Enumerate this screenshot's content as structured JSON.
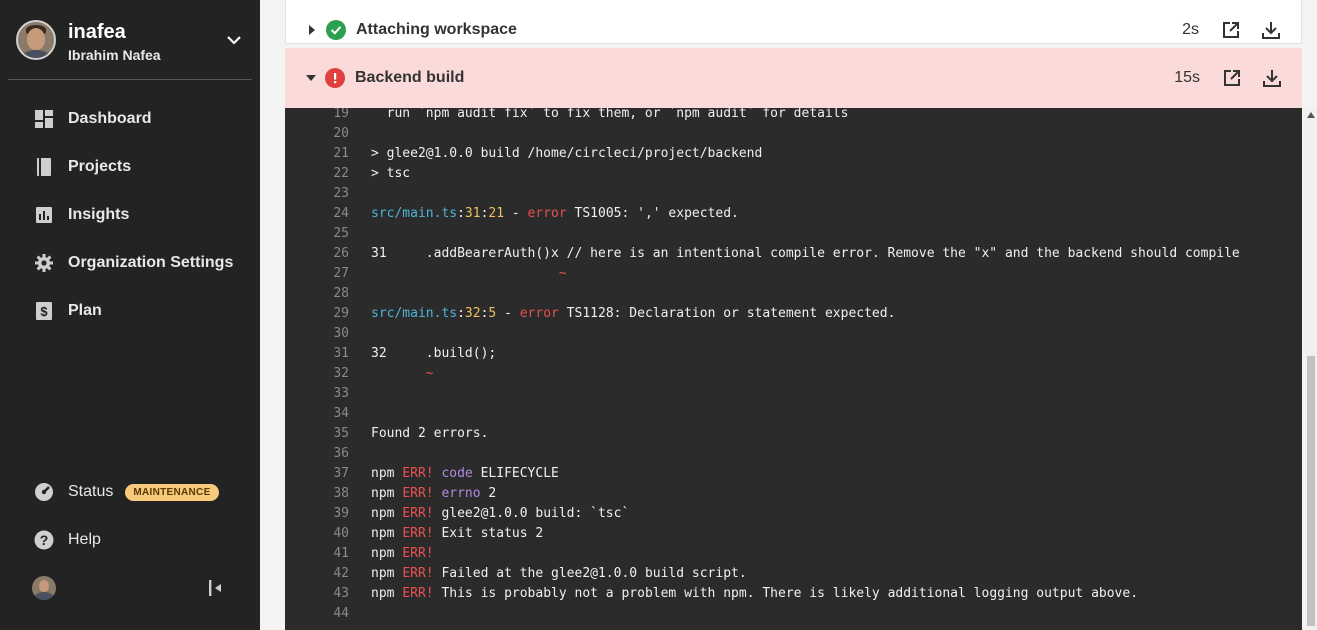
{
  "user": {
    "org": "inafea",
    "name": "Ibrahim Nafea"
  },
  "nav": {
    "items": [
      {
        "label": "Dashboard",
        "icon": "dashboard-icon"
      },
      {
        "label": "Projects",
        "icon": "projects-icon"
      },
      {
        "label": "Insights",
        "icon": "insights-icon"
      },
      {
        "label": "Organization Settings",
        "icon": "gear-icon"
      },
      {
        "label": "Plan",
        "icon": "dollar-icon"
      }
    ],
    "status_label": "Status",
    "status_badge": "MAINTENANCE",
    "help_label": "Help"
  },
  "steps": [
    {
      "title": "Attaching workspace",
      "duration": "2s",
      "state": "success"
    },
    {
      "title": "Backend build",
      "duration": "15s",
      "state": "failed"
    }
  ],
  "colors": {
    "sidebar_bg": "#232323",
    "success": "#2e9e4f",
    "error": "#e04040",
    "failed_bg": "#fbdada",
    "log_bg": "#2b2b2b"
  },
  "log_lines": [
    {
      "n": "19",
      "segs": [
        {
          "t": "  run `npm audit fix` to fix them, or `npm audit` for details",
          "c": ""
        }
      ]
    },
    {
      "n": "20",
      "segs": []
    },
    {
      "n": "21",
      "segs": [
        {
          "t": "> glee2@1.0.0 build /home/circleci/project/backend",
          "c": ""
        }
      ]
    },
    {
      "n": "22",
      "segs": [
        {
          "t": "> tsc",
          "c": ""
        }
      ]
    },
    {
      "n": "23",
      "segs": []
    },
    {
      "n": "24",
      "segs": [
        {
          "t": "src/main.ts",
          "c": "c-blue"
        },
        {
          "t": ":",
          "c": ""
        },
        {
          "t": "31",
          "c": "c-yellow"
        },
        {
          "t": ":",
          "c": ""
        },
        {
          "t": "21",
          "c": "c-yellow"
        },
        {
          "t": " - ",
          "c": ""
        },
        {
          "t": "error",
          "c": "c-red"
        },
        {
          "t": " TS1005: ',' expected.",
          "c": ""
        }
      ]
    },
    {
      "n": "25",
      "segs": []
    },
    {
      "n": "26",
      "segs": [
        {
          "t": "31     .addBearerAuth()x // here is an intentional compile error. Remove the \"x\" and the backend should compile",
          "c": ""
        }
      ]
    },
    {
      "n": "27",
      "segs": [
        {
          "t": "                        ~",
          "c": "c-red"
        }
      ]
    },
    {
      "n": "28",
      "segs": []
    },
    {
      "n": "29",
      "segs": [
        {
          "t": "src/main.ts",
          "c": "c-blue"
        },
        {
          "t": ":",
          "c": ""
        },
        {
          "t": "32",
          "c": "c-yellow"
        },
        {
          "t": ":",
          "c": ""
        },
        {
          "t": "5",
          "c": "c-yellow"
        },
        {
          "t": " - ",
          "c": ""
        },
        {
          "t": "error",
          "c": "c-red"
        },
        {
          "t": " TS1128: Declaration or statement expected.",
          "c": ""
        }
      ]
    },
    {
      "n": "30",
      "segs": []
    },
    {
      "n": "31",
      "segs": [
        {
          "t": "32     .build();",
          "c": ""
        }
      ]
    },
    {
      "n": "32",
      "segs": [
        {
          "t": "       ~",
          "c": "c-red"
        }
      ]
    },
    {
      "n": "33",
      "segs": []
    },
    {
      "n": "34",
      "segs": []
    },
    {
      "n": "35",
      "segs": [
        {
          "t": "Found 2 errors.",
          "c": ""
        }
      ]
    },
    {
      "n": "36",
      "segs": []
    },
    {
      "n": "37",
      "segs": [
        {
          "t": "npm ",
          "c": ""
        },
        {
          "t": "ERR!",
          "c": "c-red"
        },
        {
          "t": " ",
          "c": ""
        },
        {
          "t": "code",
          "c": "c-purple"
        },
        {
          "t": " ELIFECYCLE",
          "c": ""
        }
      ]
    },
    {
      "n": "38",
      "segs": [
        {
          "t": "npm ",
          "c": ""
        },
        {
          "t": "ERR!",
          "c": "c-red"
        },
        {
          "t": " ",
          "c": ""
        },
        {
          "t": "errno",
          "c": "c-purple"
        },
        {
          "t": " 2",
          "c": ""
        }
      ]
    },
    {
      "n": "39",
      "segs": [
        {
          "t": "npm ",
          "c": ""
        },
        {
          "t": "ERR!",
          "c": "c-red"
        },
        {
          "t": " glee2@1.0.0 build: `tsc`",
          "c": ""
        }
      ]
    },
    {
      "n": "40",
      "segs": [
        {
          "t": "npm ",
          "c": ""
        },
        {
          "t": "ERR!",
          "c": "c-red"
        },
        {
          "t": " Exit status 2",
          "c": ""
        }
      ]
    },
    {
      "n": "41",
      "segs": [
        {
          "t": "npm ",
          "c": ""
        },
        {
          "t": "ERR!",
          "c": "c-red"
        }
      ]
    },
    {
      "n": "42",
      "segs": [
        {
          "t": "npm ",
          "c": ""
        },
        {
          "t": "ERR!",
          "c": "c-red"
        },
        {
          "t": " Failed at the glee2@1.0.0 build script.",
          "c": ""
        }
      ]
    },
    {
      "n": "43",
      "segs": [
        {
          "t": "npm ",
          "c": ""
        },
        {
          "t": "ERR!",
          "c": "c-red"
        },
        {
          "t": " This is probably not a problem with npm. There is likely additional logging output above.",
          "c": ""
        }
      ]
    },
    {
      "n": "44",
      "segs": []
    }
  ]
}
